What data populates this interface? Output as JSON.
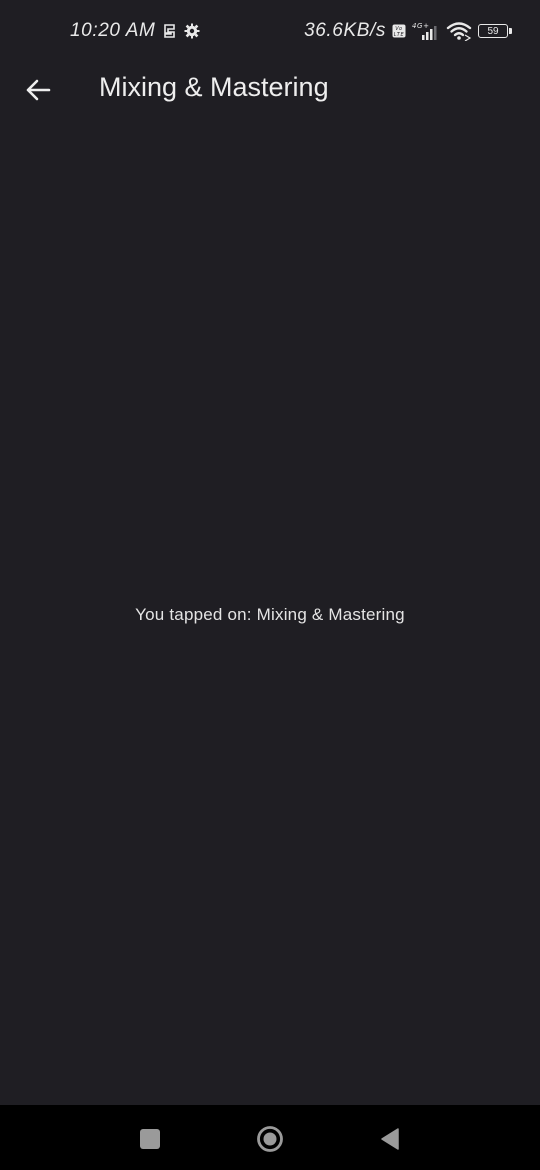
{
  "status_bar": {
    "time": "10:20 AM",
    "network_speed": "36.6KB/s",
    "network_type": "4G+",
    "volte": "Vo LTE",
    "battery": "59"
  },
  "app_bar": {
    "title": "Mixing & Mastering",
    "back_icon": "arrow-left-icon"
  },
  "main": {
    "message": "You tapped on: Mixing & Mastering"
  },
  "nav_bar": {
    "recents_icon": "square-icon",
    "home_icon": "circle-icon",
    "back_icon": "triangle-back-icon"
  },
  "colors": {
    "background": "#1f1e23",
    "nav_background": "#000000",
    "text": "#eaeaea"
  }
}
